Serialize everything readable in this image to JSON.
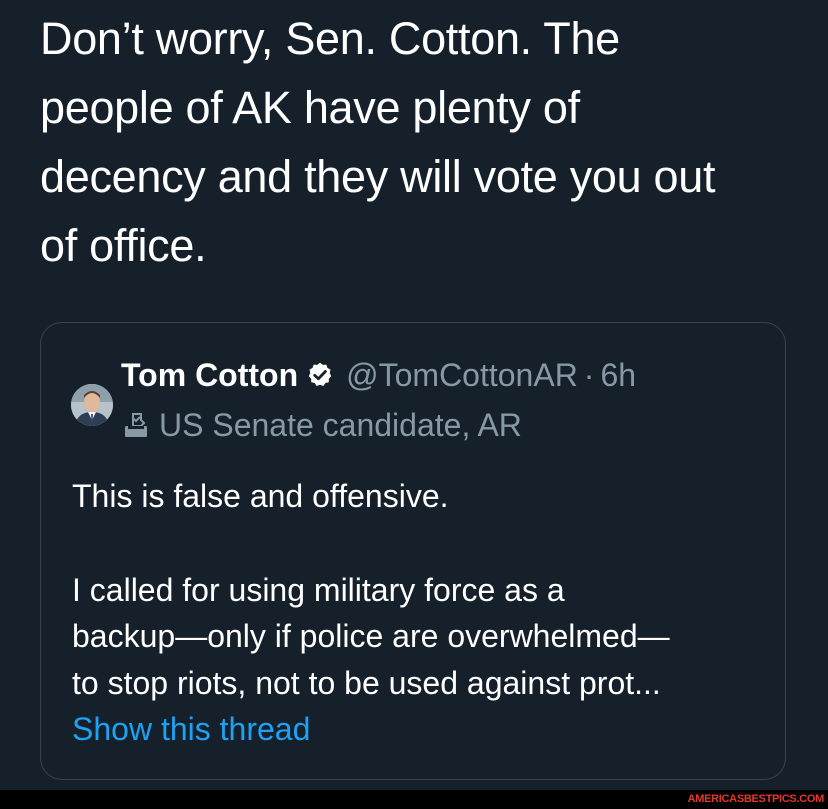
{
  "tweet": {
    "text_lines": [
      "Don’t worry, Sen. Cotton. The",
      "people of AK have plenty of",
      "decency and they will vote you out",
      "of office."
    ]
  },
  "quoted_tweet": {
    "author_name": "Tom Cotton",
    "verified_icon": "verified-badge-icon",
    "handle": "@TomCottonAR",
    "separator": "·",
    "time": "6h",
    "label_icon": "ballot-box-icon",
    "label": "US Senate candidate, AR",
    "body_paragraph_1": "This is false and offensive.",
    "body_paragraph_2_lines": [
      "I called for using military force as a",
      "backup—only if police are overwhelmed—",
      "to stop riots, not to be used against prot..."
    ],
    "show_thread": "Show this thread"
  },
  "watermark": "AMERICASBESTPICS.COM",
  "colors": {
    "background": "#15202b",
    "border": "#38444d",
    "secondary_text": "#8899a6",
    "link": "#1da1f2",
    "watermark": "#e03a2f"
  }
}
